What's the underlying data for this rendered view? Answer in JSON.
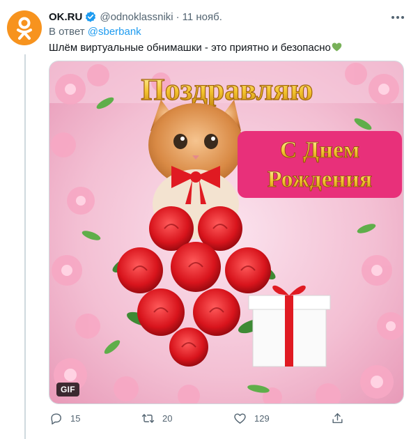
{
  "tweet": {
    "author_name": "OK.RU",
    "handle": "@odnoklassniki",
    "separator": "·",
    "date": "11 нояб.",
    "reply_prefix": "В ответ",
    "reply_mention": "@sberbank",
    "text": "Шлём виртуальные обнимашки - это приятно и безопасно",
    "text_emoji": "green-heart",
    "media": {
      "type": "gif",
      "badge": "GIF",
      "title_text": "Поздравляю",
      "banner_line1": "С Днем",
      "banner_line2": "Рождения"
    },
    "actions": {
      "reply_count": "15",
      "retweet_count": "20",
      "like_count": "129"
    }
  },
  "colors": {
    "accent": "#1d9bf0",
    "secondary_text": "#536471",
    "brand_orange": "#f7931e",
    "emoji_green": "#78b159"
  },
  "icons": [
    "ok-logo-icon",
    "verified-badge-icon",
    "more-icon",
    "reply-icon",
    "retweet-icon",
    "like-icon",
    "share-icon"
  ]
}
